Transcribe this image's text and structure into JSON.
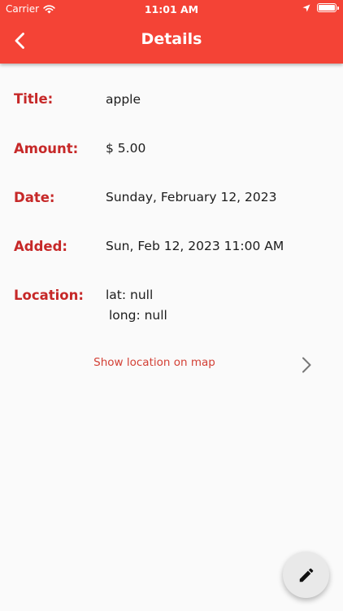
{
  "status_bar": {
    "carrier": "Carrier",
    "time": "11:01 AM",
    "icons": [
      "wifi-icon",
      "location-arrow-icon",
      "battery-icon"
    ]
  },
  "header": {
    "title": "Details",
    "back_icon": "chevron-left-icon",
    "color": "#f44336"
  },
  "details": {
    "title": {
      "label": "Title:",
      "value": "apple"
    },
    "amount": {
      "label": "Amount:",
      "value": "$ 5.00"
    },
    "date": {
      "label": "Date:",
      "value": "Sunday, February 12, 2023"
    },
    "added": {
      "label": "Added:",
      "value": "Sun, Feb 12, 2023 11:00 AM"
    },
    "location": {
      "label": "Location:",
      "lat": "lat: null",
      "long": "long: null"
    }
  },
  "map_link": {
    "label": "Show location on map",
    "icon": "chevron-right-icon"
  },
  "fab": {
    "icon": "pencil-icon"
  },
  "colors": {
    "primary": "#f44336",
    "label": "#c62828",
    "link": "#d34035"
  }
}
